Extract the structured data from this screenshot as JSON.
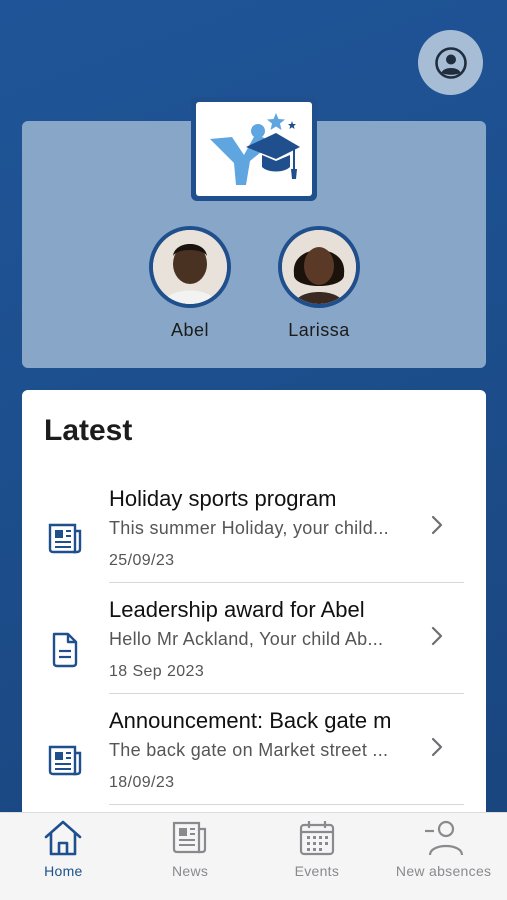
{
  "header": {
    "profile_icon": "account-circle-icon"
  },
  "school": {
    "logo": "school-logo"
  },
  "children": [
    {
      "name": "Abel"
    },
    {
      "name": "Larissa"
    }
  ],
  "latest": {
    "title": "Latest",
    "items": [
      {
        "icon": "newspaper-icon",
        "title": "Holiday sports program",
        "snippet": "This summer Holiday, your child...",
        "date": "25/09/23"
      },
      {
        "icon": "document-icon",
        "title": "Leadership award for Abel",
        "snippet": "Hello Mr Ackland, Your child Ab...",
        "date": "18 Sep 2023"
      },
      {
        "icon": "newspaper-icon",
        "title": "Announcement: Back gate m",
        "snippet": "The back gate on Market street ...",
        "date": "18/09/23"
      }
    ]
  },
  "tabbar": {
    "tabs": [
      {
        "label": "Home",
        "icon": "home-icon",
        "active": true
      },
      {
        "label": "News",
        "icon": "newspaper-icon",
        "active": false
      },
      {
        "label": "Events",
        "icon": "calendar-icon",
        "active": false
      },
      {
        "label": "New absences",
        "icon": "person-minus-icon",
        "active": false
      }
    ]
  },
  "colors": {
    "primary": "#1f4f8c",
    "panel": "#88a7c8",
    "background": "#1d4f8e"
  }
}
